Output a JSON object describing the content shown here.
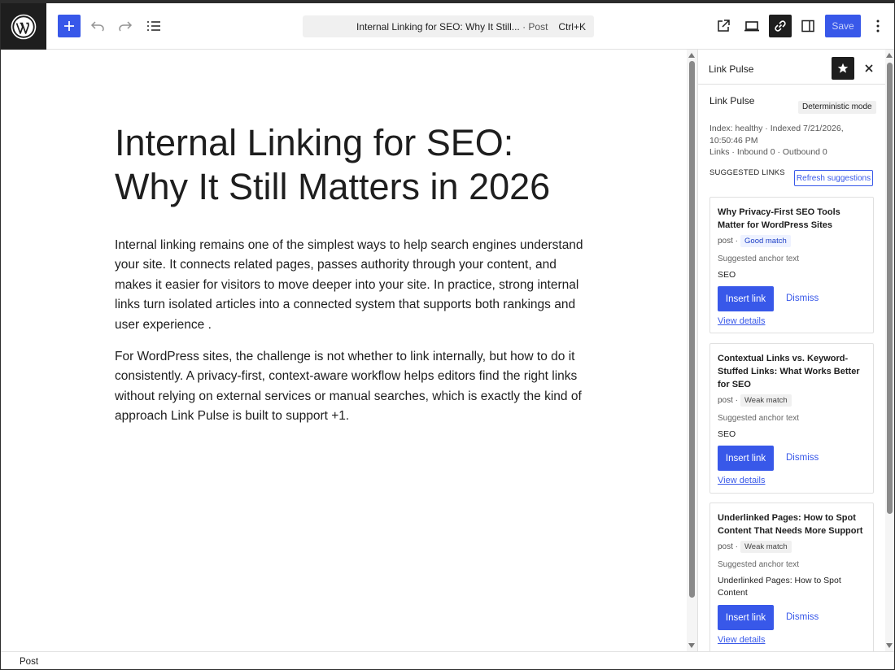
{
  "toolbar": {
    "logo_icon": "wordpress-logo",
    "add_icon": "plus-icon",
    "undo_icon": "undo-icon",
    "redo_icon": "redo-icon",
    "document_overview_icon": "list-view-icon",
    "command_title": "Internal Linking for SEO: Why It Still...",
    "command_type": "· Post",
    "command_shortcut": "Ctrl+K",
    "view_icon": "external-link-icon",
    "preview_icon": "laptop-icon",
    "link_pulse_icon": "link-icon",
    "settings_icon": "sidebar-icon",
    "save_label": "Save",
    "more_icon": "vertical-ellipsis-icon",
    "accent_color": "#3858e9"
  },
  "canvas": {
    "title": "Internal Linking for SEO: Why It Still Matters in 2026",
    "paragraphs": [
      "Internal linking remains one of the simplest ways to help search engines understand your site. It connects related pages, passes authority through your content, and makes it easier for visitors to move deeper into your site. In practice, strong internal links turn isolated articles into a connected system that supports both rankings and user experience .",
      "For WordPress sites, the challenge is not whether to link internally, but how to do it consistently. A privacy-first, context-aware workflow helps editors find the right links without relying on external services or manual searches, which is exactly the kind of approach Link Pulse is built to support +1."
    ]
  },
  "sidebar": {
    "header_title": "Link Pulse",
    "star_icon": "star-icon",
    "close_icon": "close-icon",
    "plugin_name": "Link Pulse",
    "mode_badge": "Deterministic mode",
    "status": "Index: healthy · Indexed 7/21/2026, 10:50:46 PM",
    "links_stats": "Links · Inbound 0 · Outbound 0",
    "section_heading": "SUGGESTED LINKS",
    "refresh_label": "Refresh suggestions",
    "suggestions": [
      {
        "title": "Why Privacy-First SEO Tools Matter for WordPress Sites",
        "type": "post ·",
        "match": "Good match",
        "anchor_label": "Suggested anchor text",
        "anchor": "SEO",
        "insert_label": "Insert link",
        "dismiss_label": "Dismiss",
        "details_label": "View details"
      },
      {
        "title": "Contextual Links vs. Keyword-Stuffed Links: What Works Better for SEO",
        "type": "post ·",
        "match": "Weak match",
        "anchor_label": "Suggested anchor text",
        "anchor": "SEO",
        "insert_label": "Insert link",
        "dismiss_label": "Dismiss",
        "details_label": "View details"
      },
      {
        "title": "Underlinked Pages: How to Spot Content That Needs More Support",
        "type": "post ·",
        "match": "Weak match",
        "anchor_label": "Suggested anchor text",
        "anchor": "Underlinked Pages: How to Spot Content",
        "insert_label": "Insert link",
        "dismiss_label": "Dismiss",
        "details_label": "View details"
      }
    ]
  },
  "footer": {
    "breadcrumb": "Post"
  }
}
